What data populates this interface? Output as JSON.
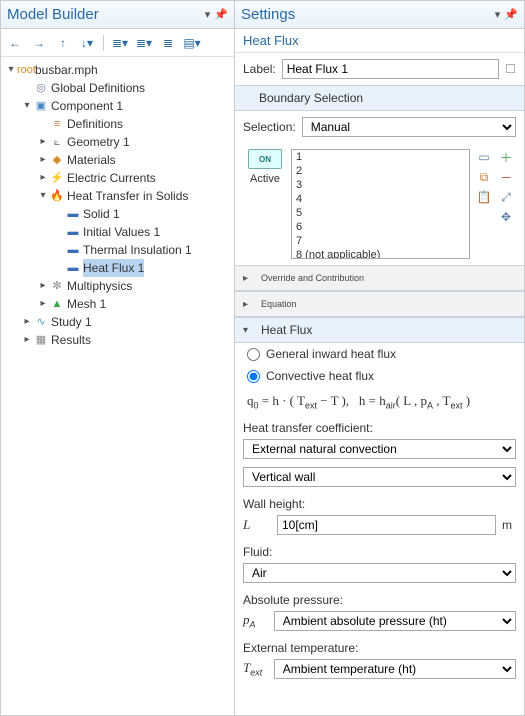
{
  "left": {
    "title": "Model Builder",
    "toolbar": [
      "←",
      "→",
      "↑",
      "↓",
      "≡",
      "≣",
      "≣",
      "≡"
    ],
    "tree": [
      {
        "ind": 0,
        "tw": "▾",
        "icon": "root",
        "cls": "root",
        "label": "busbar.mph"
      },
      {
        "ind": 1,
        "tw": "",
        "icon": "◎",
        "cls": "globe",
        "label": "Global Definitions"
      },
      {
        "ind": 1,
        "tw": "▾",
        "icon": "▣",
        "cls": "comp",
        "label": "Component 1"
      },
      {
        "ind": 2,
        "tw": "",
        "icon": "≡",
        "cls": "def",
        "label": "Definitions"
      },
      {
        "ind": 2,
        "tw": "▸",
        "icon": "⟀",
        "cls": "geo",
        "label": "Geometry 1"
      },
      {
        "ind": 2,
        "tw": "▸",
        "icon": "◆",
        "cls": "mat",
        "label": "Materials"
      },
      {
        "ind": 2,
        "tw": "▸",
        "icon": "⚡",
        "cls": "ec",
        "label": "Electric Currents"
      },
      {
        "ind": 2,
        "tw": "▾",
        "icon": "🔥",
        "cls": "ht",
        "label": "Heat Transfer in Solids"
      },
      {
        "ind": 3,
        "tw": "",
        "icon": "▬",
        "cls": "solid",
        "label": "Solid 1"
      },
      {
        "ind": 3,
        "tw": "",
        "icon": "▬",
        "cls": "iv",
        "label": "Initial Values 1"
      },
      {
        "ind": 3,
        "tw": "",
        "icon": "▬",
        "cls": "ti",
        "label": "Thermal Insulation 1"
      },
      {
        "ind": 3,
        "tw": "",
        "icon": "▬",
        "cls": "hf",
        "label": "Heat Flux 1",
        "sel": true
      },
      {
        "ind": 2,
        "tw": "▸",
        "icon": "✼",
        "cls": "mp",
        "label": "Multiphysics"
      },
      {
        "ind": 2,
        "tw": "▸",
        "icon": "▲",
        "cls": "mesh",
        "label": "Mesh 1"
      },
      {
        "ind": 1,
        "tw": "▸",
        "icon": "∿",
        "cls": "study",
        "label": "Study 1"
      },
      {
        "ind": 1,
        "tw": "▸",
        "icon": "▦",
        "cls": "res",
        "label": "Results"
      }
    ]
  },
  "right": {
    "title": "Settings",
    "subtitle": "Heat Flux",
    "label_lbl": "Label:",
    "label_val": "Heat Flux 1",
    "boundary": {
      "header": "Boundary Selection",
      "sel_lbl": "Selection:",
      "sel_val": "Manual",
      "active_lbl": "Active",
      "on": "ON",
      "list": [
        "1",
        "2",
        "3",
        "4",
        "5",
        "6",
        "7",
        "8 (not applicable)"
      ]
    },
    "sections": {
      "override": "Override and Contribution",
      "equation": "Equation",
      "heatflux": "Heat Flux"
    },
    "radios": {
      "r1": "General inward heat flux",
      "r2": "Convective heat flux"
    },
    "formula_html": "q<span class='sub'>0</span> = h · ( T<span class='sub'>ext</span> − T ),&nbsp;&nbsp; h = h<span class='sub'>air</span>( L , p<span class='sub'>A</span> , T<span class='sub'>ext</span> )",
    "htc_lbl": "Heat transfer coefficient:",
    "htc_val1": "External natural convection",
    "htc_val2": "Vertical wall",
    "wall_lbl": "Wall height:",
    "wall_sym": "L",
    "wall_val": "10[cm]",
    "wall_unit": "m",
    "fluid_lbl": "Fluid:",
    "fluid_val": "Air",
    "p_lbl": "Absolute pressure:",
    "p_sym": "p<span class='sub'>A</span>",
    "p_val": "Ambient absolute pressure (ht)",
    "t_lbl": "External temperature:",
    "t_sym": "T<span class='sub'>ext</span>",
    "t_val": "Ambient temperature (ht)"
  }
}
